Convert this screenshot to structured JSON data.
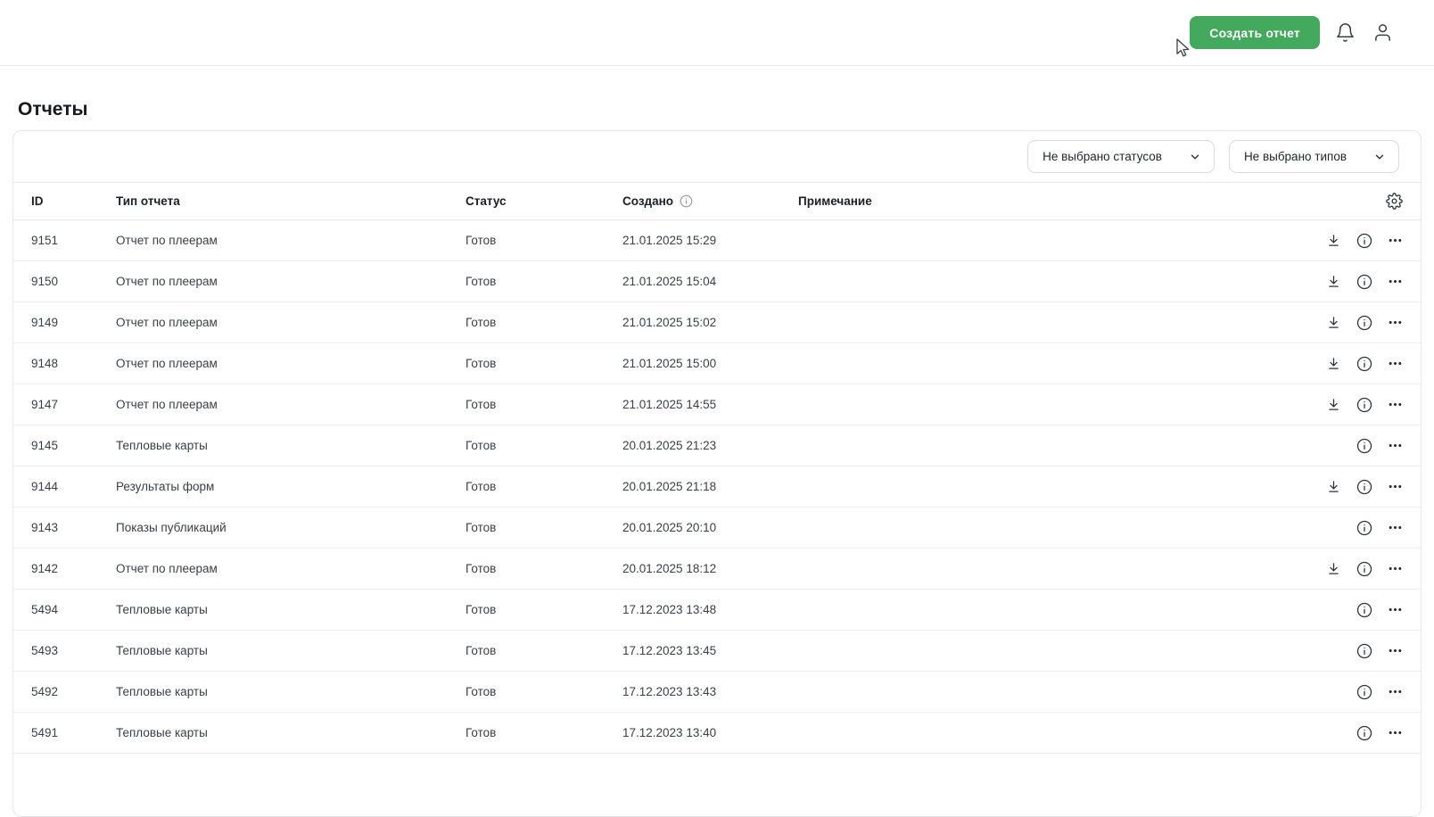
{
  "topbar": {
    "create_report_label": "Создать отчет"
  },
  "page": {
    "title": "Отчеты"
  },
  "filters": {
    "status_placeholder": "Не выбрано статусов",
    "type_placeholder": "Не выбрано типов"
  },
  "table": {
    "columns": {
      "id": "ID",
      "type": "Тип отчета",
      "status": "Статус",
      "created": "Создано",
      "note": "Примечание"
    },
    "rows": [
      {
        "id": "9151",
        "type": "Отчет по плеерам",
        "status": "Готов",
        "created": "21.01.2025 15:29",
        "note": "",
        "download": true
      },
      {
        "id": "9150",
        "type": "Отчет по плеерам",
        "status": "Готов",
        "created": "21.01.2025 15:04",
        "note": "",
        "download": true
      },
      {
        "id": "9149",
        "type": "Отчет по плеерам",
        "status": "Готов",
        "created": "21.01.2025 15:02",
        "note": "",
        "download": true
      },
      {
        "id": "9148",
        "type": "Отчет по плеерам",
        "status": "Готов",
        "created": "21.01.2025 15:00",
        "note": "",
        "download": true
      },
      {
        "id": "9147",
        "type": "Отчет по плеерам",
        "status": "Готов",
        "created": "21.01.2025 14:55",
        "note": "",
        "download": true
      },
      {
        "id": "9145",
        "type": "Тепловые карты",
        "status": "Готов",
        "created": "20.01.2025 21:23",
        "note": "",
        "download": false
      },
      {
        "id": "9144",
        "type": "Результаты форм",
        "status": "Готов",
        "created": "20.01.2025 21:18",
        "note": "",
        "download": true
      },
      {
        "id": "9143",
        "type": "Показы публикаций",
        "status": "Готов",
        "created": "20.01.2025 20:10",
        "note": "",
        "download": false
      },
      {
        "id": "9142",
        "type": "Отчет по плеерам",
        "status": "Готов",
        "created": "20.01.2025 18:12",
        "note": "",
        "download": true
      },
      {
        "id": "5494",
        "type": "Тепловые карты",
        "status": "Готов",
        "created": "17.12.2023 13:48",
        "note": "",
        "download": false
      },
      {
        "id": "5493",
        "type": "Тепловые карты",
        "status": "Готов",
        "created": "17.12.2023 13:45",
        "note": "",
        "download": false
      },
      {
        "id": "5492",
        "type": "Тепловые карты",
        "status": "Готов",
        "created": "17.12.2023 13:43",
        "note": "",
        "download": false
      },
      {
        "id": "5491",
        "type": "Тепловые карты",
        "status": "Готов",
        "created": "17.12.2023 13:40",
        "note": "",
        "download": false
      }
    ]
  },
  "icons": {
    "notifications": "bell-icon",
    "account": "user-icon",
    "settings": "gear-icon",
    "column_info": "info-icon",
    "row_download": "download-icon",
    "row_info": "info-icon",
    "row_more": "ellipsis-icon",
    "dropdown": "chevron-down-icon"
  },
  "colors": {
    "accent_green": "#43a95c",
    "border": "#e4e7ea",
    "text_primary": "#1b1e24",
    "text_secondary": "#3a3e46"
  }
}
